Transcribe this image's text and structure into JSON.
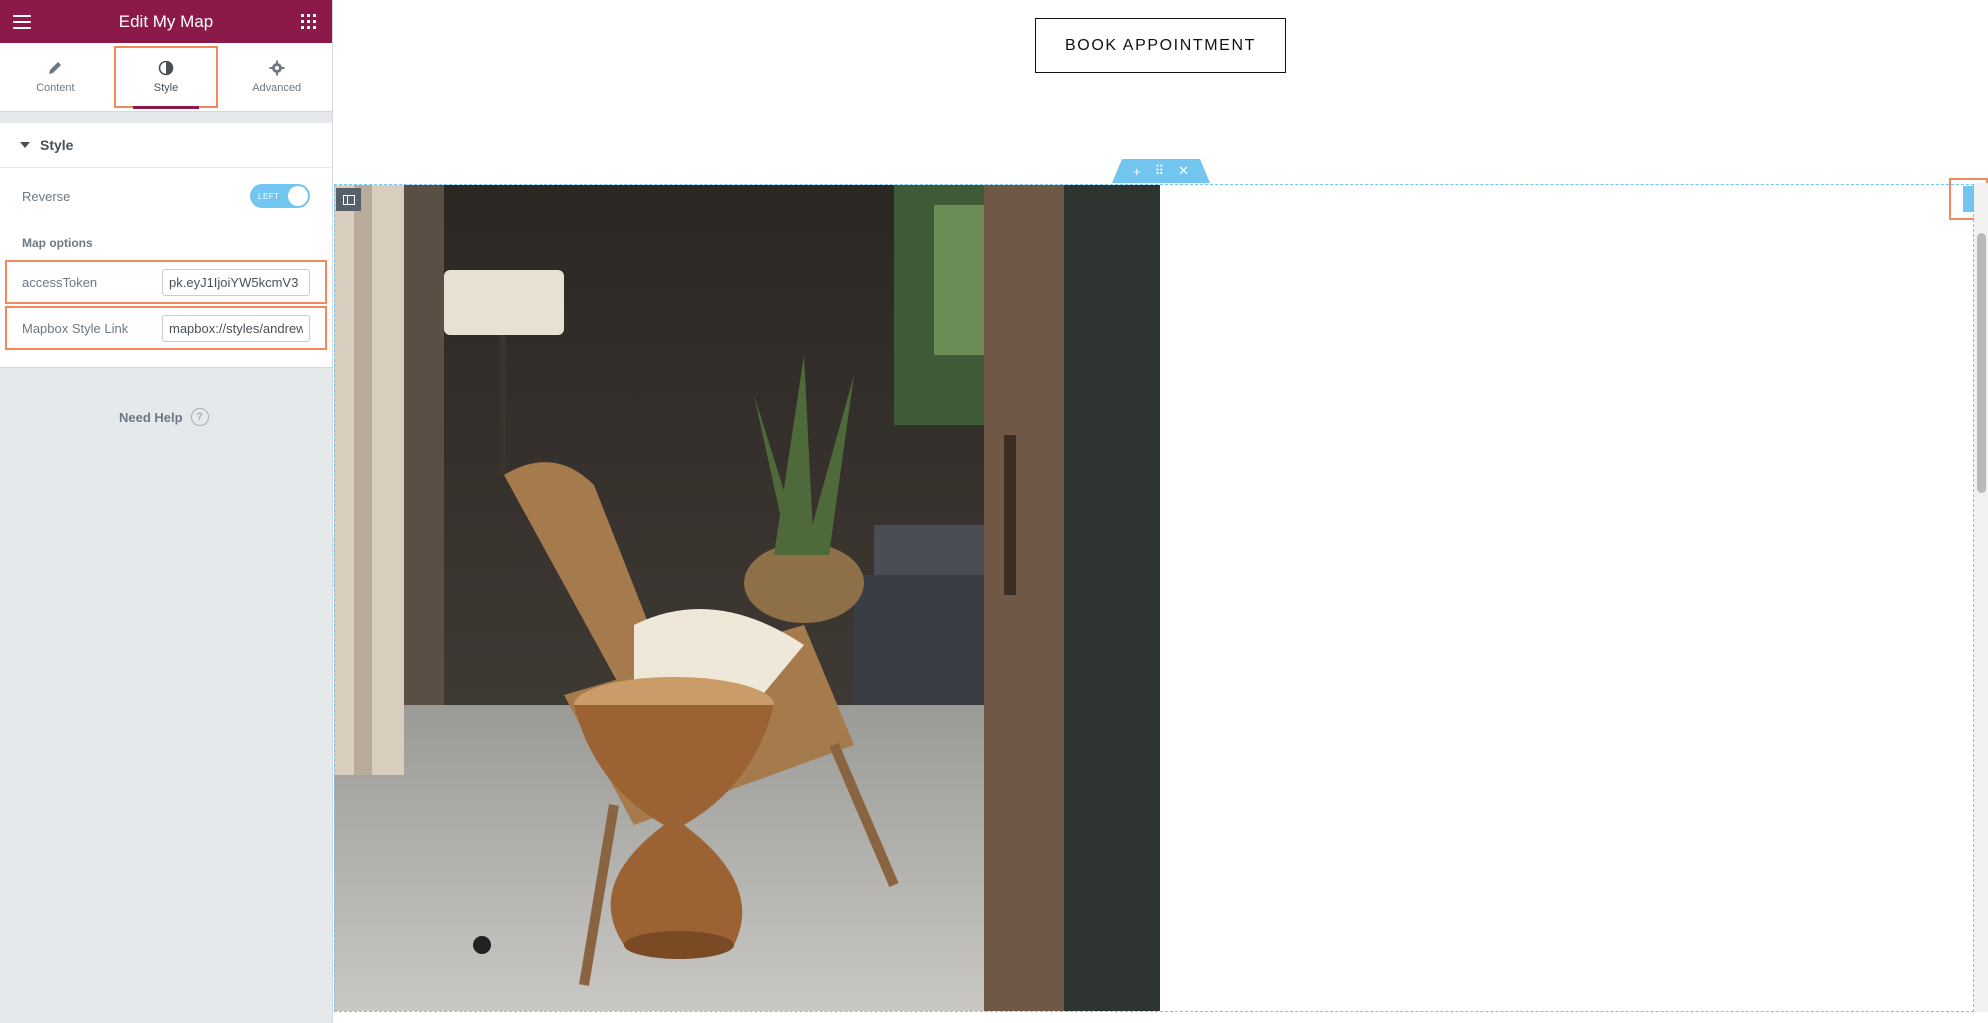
{
  "sidebar": {
    "header": {
      "title": "Edit My Map"
    },
    "tabs": [
      {
        "label": "Content",
        "icon": "pencil-icon",
        "active": false
      },
      {
        "label": "Style",
        "icon": "contrast-icon",
        "active": true
      },
      {
        "label": "Advanced",
        "icon": "gear-icon",
        "active": false
      }
    ],
    "section": {
      "title": "Style"
    },
    "reverse": {
      "label": "Reverse",
      "toggle_text": "LEFT"
    },
    "map_options": {
      "label": "Map options",
      "access_token": {
        "label": "accessToken",
        "value": "pk.eyJ1IjoiYW5kcmV3"
      },
      "style_link": {
        "label": "Mapbox Style Link",
        "value": "mapbox://styles/andrew"
      }
    },
    "help": {
      "label": "Need Help",
      "icon_glyph": "?"
    }
  },
  "canvas": {
    "book_button": {
      "label": "BOOK APPOINTMENT"
    },
    "section_tools": {
      "add": "+",
      "move": "⠿",
      "close": "✕"
    }
  },
  "colors": {
    "header": "#8b1a4a",
    "accent": "#71c5ef",
    "highlight": "#f08a5d"
  }
}
